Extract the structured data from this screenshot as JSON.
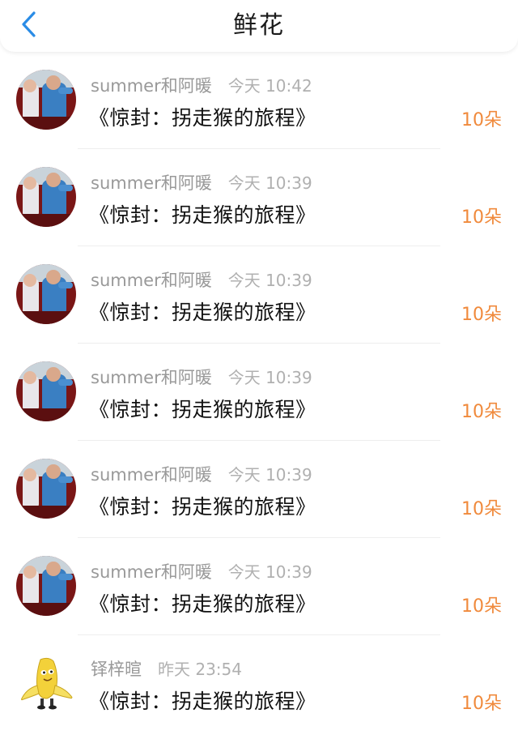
{
  "header": {
    "title": "鲜花",
    "back_icon": "chevron-left-icon",
    "accent": "#2a8ce6"
  },
  "colors": {
    "amount": "#f08a3c",
    "username": "#999999"
  },
  "flowers": [
    {
      "user": "summer和阿暖",
      "time": "今天 10:42",
      "book": "《惊封：拐走猴的旅程》",
      "amount": "10朵",
      "avatar": "photo"
    },
    {
      "user": "summer和阿暖",
      "time": "今天 10:39",
      "book": "《惊封：拐走猴的旅程》",
      "amount": "10朵",
      "avatar": "photo"
    },
    {
      "user": "summer和阿暖",
      "time": "今天 10:39",
      "book": "《惊封：拐走猴的旅程》",
      "amount": "10朵",
      "avatar": "photo"
    },
    {
      "user": "summer和阿暖",
      "time": "今天 10:39",
      "book": "《惊封：拐走猴的旅程》",
      "amount": "10朵",
      "avatar": "photo"
    },
    {
      "user": "summer和阿暖",
      "time": "今天 10:39",
      "book": "《惊封：拐走猴的旅程》",
      "amount": "10朵",
      "avatar": "photo"
    },
    {
      "user": "summer和阿暖",
      "time": "今天 10:39",
      "book": "《惊封：拐走猴的旅程》",
      "amount": "10朵",
      "avatar": "photo"
    },
    {
      "user": "铎梓暄",
      "time": "昨天 23:54",
      "book": "《惊封：拐走猴的旅程》",
      "amount": "10朵",
      "avatar": "banana"
    }
  ]
}
